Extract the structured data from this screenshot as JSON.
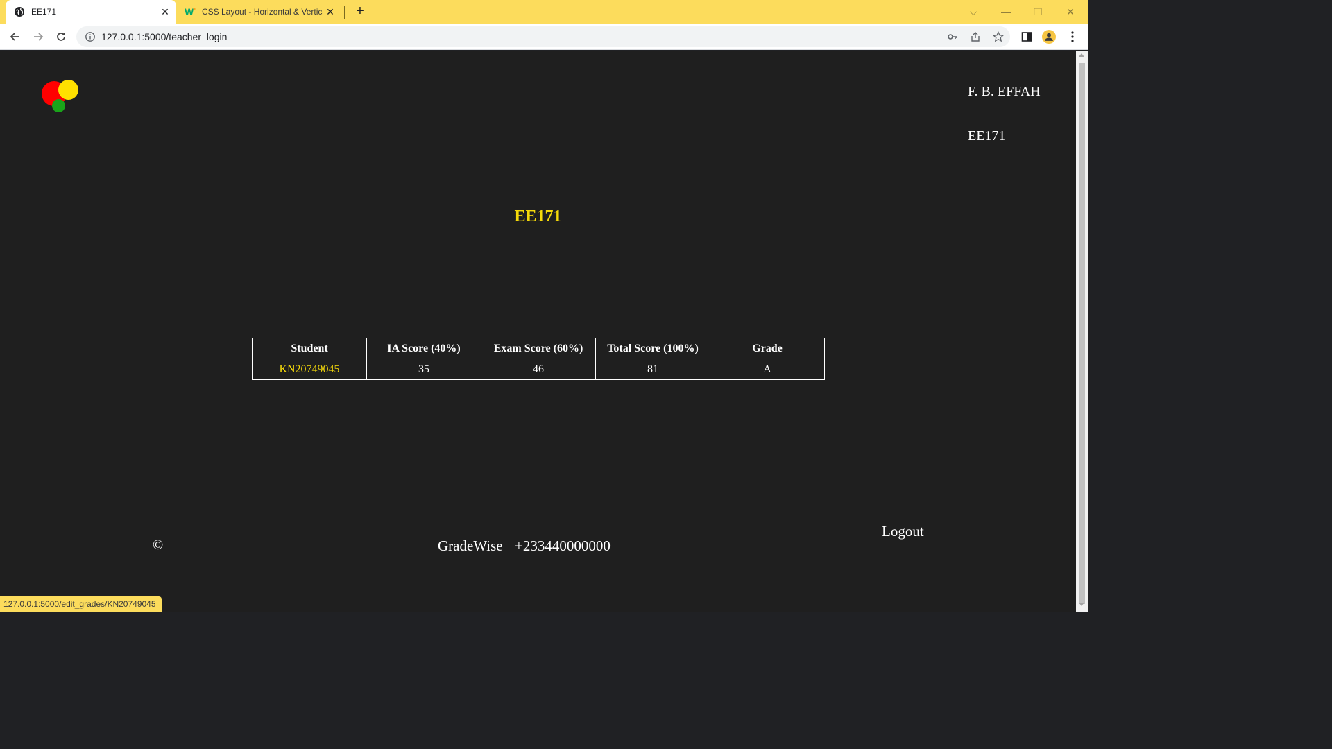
{
  "browser": {
    "tabs": [
      {
        "title": "EE171",
        "active": true,
        "icon": "globe-icon"
      },
      {
        "title": "CSS Layout - Horizontal & Vertical Align",
        "active": false,
        "icon": "w3schools-icon"
      }
    ],
    "url": "127.0.0.1:5000/teacher_login",
    "status_url": "127.0.0.1:5000/edit_grades/KN20749045",
    "accent_color": "#fcdc5c"
  },
  "header": {
    "user_name": "F. B. EFFAH",
    "course_code": "EE171",
    "logo_colors": [
      "#ff0000",
      "#ffe000",
      "#1aa31a"
    ]
  },
  "main": {
    "title": "EE171",
    "title_color": "#f5d90a",
    "table": {
      "columns": [
        "Student",
        "IA Score (40%)",
        "Exam Score (60%)",
        "Total Score (100%)",
        "Grade"
      ],
      "rows": [
        {
          "student": "KN20749045",
          "ia_score": "35",
          "exam_score": "46",
          "total_score": "81",
          "grade": "A"
        }
      ]
    }
  },
  "footer": {
    "logout_label": "Logout",
    "copyright": "©",
    "brand": "GradeWise",
    "phone": "+233440000000"
  }
}
